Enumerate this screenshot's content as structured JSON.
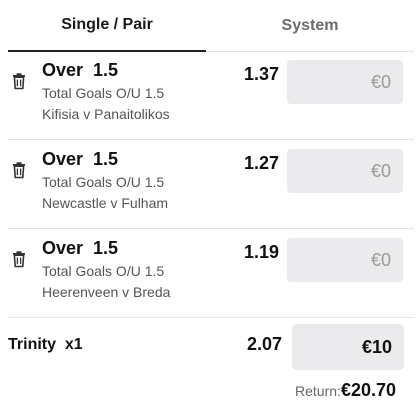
{
  "tabs": [
    {
      "label": "Single / Pair",
      "active": true
    },
    {
      "label": "System",
      "active": false
    }
  ],
  "bets": [
    {
      "selection": "Over  1.5",
      "market": "Total Goals O/U 1.5",
      "match": "Kifisia v Panaitolikos",
      "odds": "1.37",
      "stake_placeholder": "€0"
    },
    {
      "selection": "Over  1.5",
      "market": "Total Goals O/U 1.5",
      "match": "Newcastle v Fulham",
      "odds": "1.27",
      "stake_placeholder": "€0"
    },
    {
      "selection": "Over  1.5",
      "market": "Total Goals O/U 1.5",
      "match": "Heerenveen v Breda",
      "odds": "1.19",
      "stake_placeholder": "€0"
    }
  ],
  "system": {
    "name": "Trinity  x1",
    "odds": "2.07",
    "stake": "€10"
  },
  "return": {
    "label": "Return:",
    "amount": "€20.70"
  },
  "icons": {
    "delete": "trash-icon"
  },
  "colors": {
    "input_bg": "#ebebed",
    "divider": "#e6e6e6",
    "muted": "#6b6b6b"
  }
}
